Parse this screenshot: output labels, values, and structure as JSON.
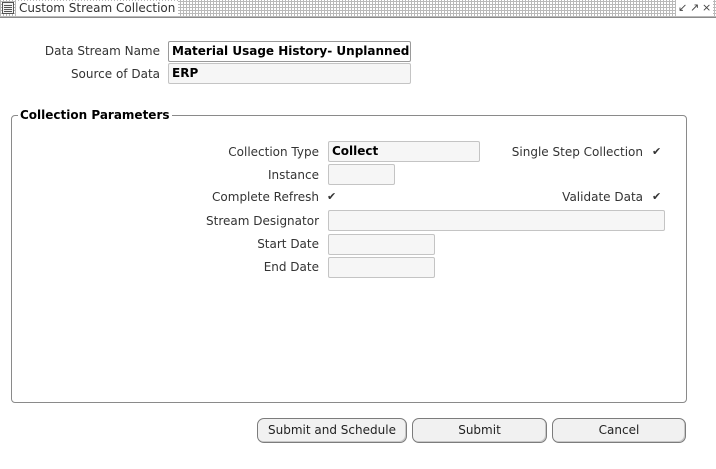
{
  "window": {
    "title": "Custom Stream Collection",
    "controls": [
      "↙",
      "↗",
      "×"
    ]
  },
  "header": {
    "data_stream_name_label": "Data Stream Name",
    "data_stream_name_value": "Material Usage History- Unplanned Maint",
    "source_of_data_label": "Source of Data",
    "source_of_data_value": "ERP"
  },
  "collection_parameters": {
    "title": "Collection Parameters",
    "collection_type_label": "Collection Type",
    "collection_type_value": "Collect",
    "single_step_label": "Single Step Collection",
    "single_step_checked": true,
    "instance_label": "Instance",
    "instance_value": "",
    "complete_refresh_label": "Complete Refresh",
    "complete_refresh_checked": true,
    "validate_data_label": "Validate Data",
    "validate_data_checked": true,
    "stream_designator_label": "Stream Designator",
    "stream_designator_value": "",
    "start_date_label": "Start Date",
    "start_date_value": "",
    "end_date_label": "End Date",
    "end_date_value": ""
  },
  "buttons": {
    "submit_and_schedule": "Submit and Schedule",
    "submit": "Submit",
    "cancel": "Cancel"
  },
  "check_glyph": "✔"
}
